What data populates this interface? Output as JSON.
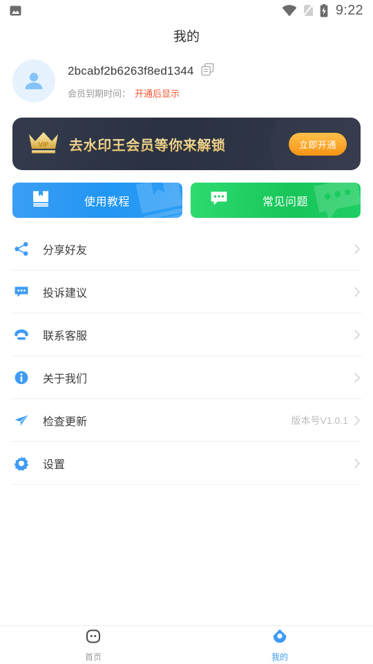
{
  "statusbar": {
    "left_icon": "image-icon",
    "wifi_icon": "wifi-icon",
    "sim_icon": "sim-off-icon",
    "battery_icon": "battery-charging-icon",
    "time": "9:22"
  },
  "header": {
    "title": "我的"
  },
  "profile": {
    "avatar_icon": "user-avatar-icon",
    "user_id": "2bcabf2b6263f8ed1344",
    "copy_icon": "copy-icon",
    "membership_label": "会员到期时间：",
    "membership_value": "开通后显示",
    "membership_value_color": "#f4522e"
  },
  "vip_banner": {
    "crown_icon": "vip-crown-icon",
    "crown_text": "VIP",
    "text": "去水印王会员等你来解锁",
    "button_label": "立即开通",
    "bg_color": "#2d3444",
    "text_color": "#eccd7f",
    "button_color": "#f9a51c"
  },
  "action_cards": [
    {
      "label": "使用教程",
      "icon": "book-icon",
      "color": "#2f9ef4",
      "name": "tutorial-card"
    },
    {
      "label": "常见问题",
      "icon": "chat-icon",
      "color": "#1bcb5f",
      "name": "faq-card"
    }
  ],
  "menu": [
    {
      "label": "分享好友",
      "icon": "share-icon",
      "extra": "",
      "name": "share-friends"
    },
    {
      "label": "投诉建议",
      "icon": "feedback-icon",
      "extra": "",
      "name": "feedback"
    },
    {
      "label": "联系客服",
      "icon": "phone-icon",
      "extra": "",
      "name": "contact-support"
    },
    {
      "label": "关于我们",
      "icon": "info-icon",
      "extra": "",
      "name": "about-us"
    },
    {
      "label": "检查更新",
      "icon": "send-icon",
      "extra": "版本号V1.0.1",
      "name": "check-update"
    },
    {
      "label": "设置",
      "icon": "gear-icon",
      "extra": "",
      "name": "settings"
    }
  ],
  "bottom_nav": [
    {
      "label": "首页",
      "icon": "home-face-icon",
      "active": false,
      "name": "nav-home"
    },
    {
      "label": "我的",
      "icon": "profile-house-icon",
      "active": true,
      "name": "nav-mine"
    }
  ],
  "colors": {
    "accent_blue": "#3d9bf7",
    "accent_green": "#1bcb5f",
    "accent_orange": "#f9a51c",
    "text_primary": "#3c3c3c",
    "text_muted": "#9a9a9a",
    "divider": "#f0f0f0"
  }
}
